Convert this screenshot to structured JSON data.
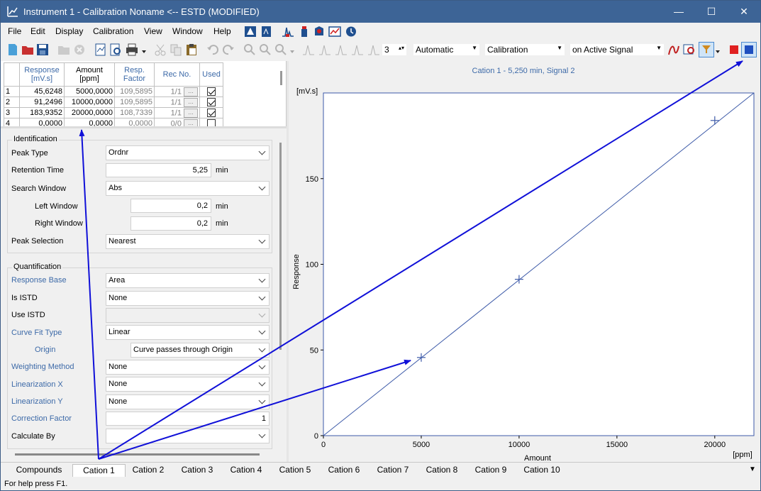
{
  "window": {
    "title": "Instrument 1 - Calibration Noname <-- ESTD (MODIFIED)",
    "minimize": "—",
    "maximize": "☐",
    "close": "✕"
  },
  "menu": [
    "File",
    "Edit",
    "Display",
    "Calibration",
    "View",
    "Window",
    "Help"
  ],
  "toolbar": {
    "level_value": "3",
    "mode": "Automatic",
    "calibration": "Calibration",
    "signal": "on Active Signal"
  },
  "table": {
    "headers": [
      "Response\n[mV.s]",
      "Amount\n[ppm]",
      "Resp.\nFactor",
      "Rec No.",
      "Used"
    ],
    "rows": [
      {
        "n": "1",
        "response": "45,6248",
        "amount": "5000,0000",
        "factor": "109,5895",
        "rec": "1/1",
        "used": true
      },
      {
        "n": "2",
        "response": "91,2496",
        "amount": "10000,0000",
        "factor": "109,5895",
        "rec": "1/1",
        "used": true
      },
      {
        "n": "3",
        "response": "183,9352",
        "amount": "20000,0000",
        "factor": "108,7339",
        "rec": "1/1",
        "used": true
      },
      {
        "n": "4",
        "response": "0,0000",
        "amount": "0,0000",
        "factor": "0,0000",
        "rec": "0/0",
        "used": false
      }
    ]
  },
  "identification": {
    "title": "Identification",
    "peak_type_label": "Peak Type",
    "peak_type": "Ordnr",
    "retention_time_label": "Retention Time",
    "retention_time": "5,25",
    "retention_time_unit": "min",
    "search_window_label": "Search Window",
    "search_window": "Abs",
    "left_window_label": "Left Window",
    "left_window": "0,2",
    "left_window_unit": "min",
    "right_window_label": "Right Window",
    "right_window": "0,2",
    "right_window_unit": "min",
    "peak_selection_label": "Peak Selection",
    "peak_selection": "Nearest"
  },
  "quantification": {
    "title": "Quantification",
    "response_base_label": "Response Base",
    "response_base": "Area",
    "is_istd_label": "Is ISTD",
    "is_istd": "None",
    "use_istd_label": "Use ISTD",
    "use_istd": "",
    "curve_fit_label": "Curve Fit Type",
    "curve_fit": "Linear",
    "origin_label": "Origin",
    "origin": "Curve passes through Origin",
    "weighting_label": "Weighting Method",
    "weighting": "None",
    "lin_x_label": "Linearization X",
    "lin_x": "None",
    "lin_y_label": "Linearization Y",
    "lin_y": "None",
    "correction_label": "Correction Factor",
    "correction": "1",
    "calc_by_label": "Calculate By",
    "calc_by": ""
  },
  "chart_data": {
    "type": "scatter",
    "title": "Cation 1 - 5,250 min, Signal 2",
    "xlabel": "Amount",
    "xunit": "[ppm]",
    "ylabel": "Response",
    "yunit": "[mV.s]",
    "xlim": [
      0,
      22000
    ],
    "ylim": [
      0,
      200
    ],
    "xticks": [
      0,
      5000,
      10000,
      15000,
      20000
    ],
    "yticks": [
      0,
      50,
      100,
      150
    ],
    "points": [
      {
        "x": 5000,
        "y": 45.6248
      },
      {
        "x": 10000,
        "y": 91.2496
      },
      {
        "x": 20000,
        "y": 183.9352
      }
    ],
    "fit_line": {
      "x": [
        0,
        22000
      ],
      "y": [
        0,
        200
      ]
    },
    "colors": {
      "line": "#3d5aa8",
      "marker": "#3d5aa8",
      "title": "#3d6aa8"
    }
  },
  "tabs": [
    "Compounds",
    "Cation 1",
    "Cation 2",
    "Cation 3",
    "Cation 4",
    "Cation 5",
    "Cation 6",
    "Cation 7",
    "Cation 8",
    "Cation 9",
    "Cation 10"
  ],
  "active_tab": "Cation 1",
  "status": "For help press F1.",
  "annotation_color": "#1010d8"
}
